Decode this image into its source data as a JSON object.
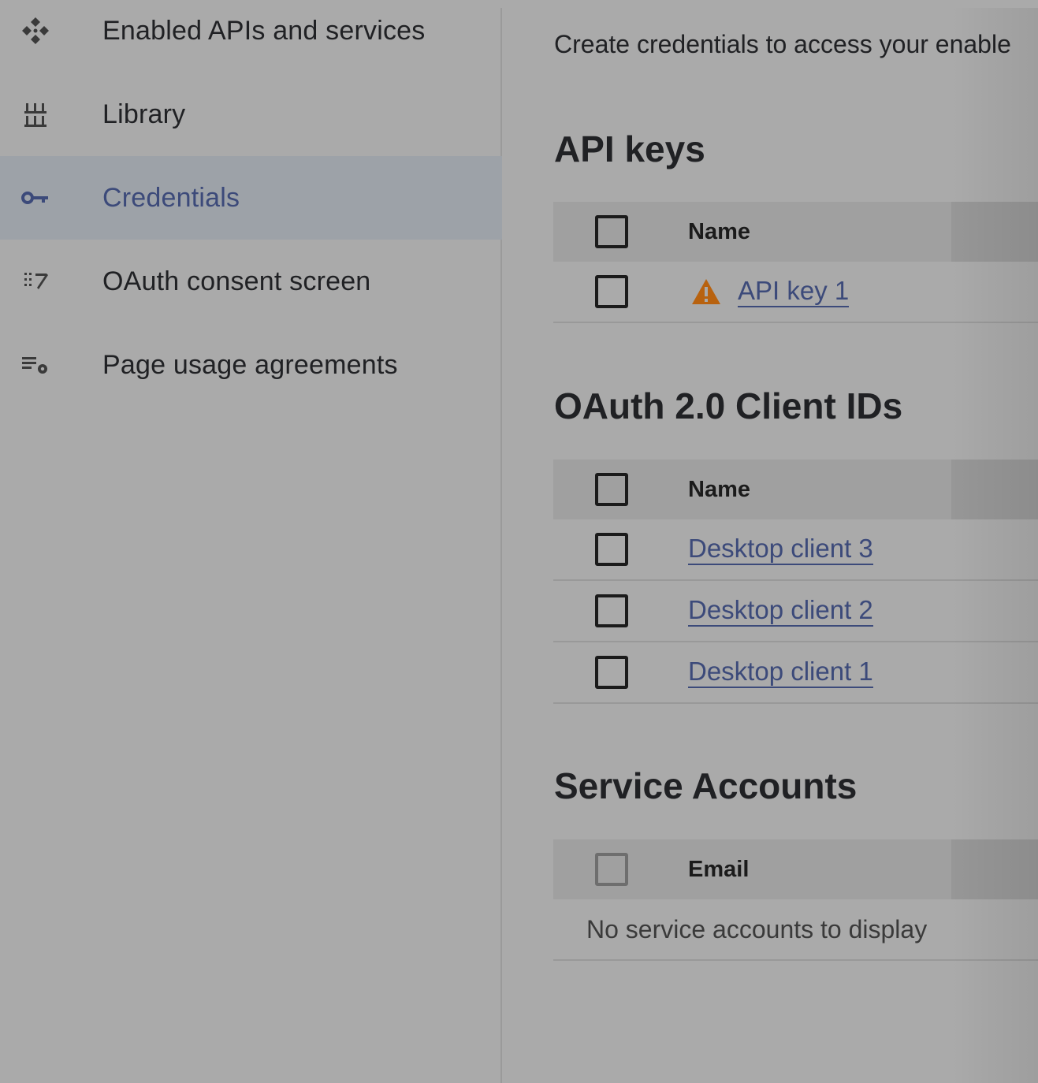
{
  "sidebar": {
    "items": [
      {
        "label": "Enabled APIs and services",
        "icon": "apis-diamond-icon"
      },
      {
        "label": "Library",
        "icon": "library-icon"
      },
      {
        "label": "Credentials",
        "icon": "key-icon",
        "active": true
      },
      {
        "label": "OAuth consent screen",
        "icon": "consent-icon"
      },
      {
        "label": "Page usage agreements",
        "icon": "list-settings-icon"
      }
    ]
  },
  "main": {
    "intro": "Create credentials to access your enable",
    "api_keys": {
      "title": "API keys",
      "header": "Name",
      "rows": [
        {
          "name": "API key 1",
          "warning": true
        }
      ]
    },
    "oauth": {
      "title": "OAuth 2.0 Client IDs",
      "header": "Name",
      "rows": [
        {
          "name": "Desktop client 3"
        },
        {
          "name": "Desktop client 2"
        },
        {
          "name": "Desktop client 1"
        }
      ]
    },
    "service_accounts": {
      "title": "Service Accounts",
      "header": "Email",
      "empty": "No service accounts to display"
    }
  },
  "colors": {
    "accent": "#3c4a7a",
    "warning": "#b8620f",
    "overlay_bg": "#aaaaaa"
  }
}
